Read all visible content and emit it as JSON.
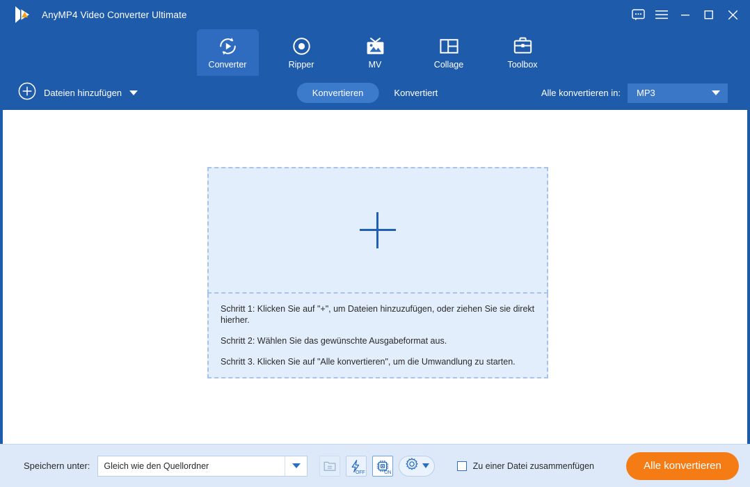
{
  "window": {
    "title": "AnyMP4 Video Converter Ultimate",
    "controls": [
      {
        "name": "feedback-icon",
        "label": "Feedback"
      },
      {
        "name": "menu-icon",
        "label": "Menu"
      },
      {
        "name": "minimize-icon",
        "label": "Minimieren"
      },
      {
        "name": "maximize-icon",
        "label": "Maximieren"
      },
      {
        "name": "close-icon",
        "label": "Schließen"
      }
    ]
  },
  "tabs": [
    {
      "label": "Converter",
      "icon": "convert-icon",
      "active": true
    },
    {
      "label": "Ripper",
      "icon": "disc-icon",
      "active": false
    },
    {
      "label": "MV",
      "icon": "mv-icon",
      "active": false
    },
    {
      "label": "Collage",
      "icon": "collage-icon",
      "active": false
    },
    {
      "label": "Toolbox",
      "icon": "toolbox-icon",
      "active": false
    }
  ],
  "toolbar": {
    "add_files_label": "Dateien hinzufügen",
    "add_files_icon": "plus-circle-icon",
    "segment_converting": "Konvertieren",
    "segment_converted": "Konvertiert",
    "convert_all_label": "Alle konvertieren in:",
    "format_value": "MP3"
  },
  "dropzone": {
    "plus_icon": "plus-icon",
    "steps": [
      "Schritt 1: Klicken Sie auf \"+\", um Dateien hinzuzufügen, oder ziehen Sie sie direkt hierher.",
      "Schritt 2: Wählen Sie das gewünschte Ausgabeformat aus.",
      "Schritt 3. Klicken Sie auf \"Alle konvertieren\", um die Umwandlung zu starten."
    ]
  },
  "bottom": {
    "save_to_label": "Speichern unter:",
    "save_to_value": "Gleich wie den Quellordner",
    "save_to_placeholder": "Gleich wie den Quellordner",
    "icons": [
      {
        "name": "open-folder-icon",
        "badge": ""
      },
      {
        "name": "fast-conversion-icon",
        "badge": "OFF"
      },
      {
        "name": "hardware-acceleration-icon",
        "badge": "ON"
      },
      {
        "name": "preferences-gear-icon",
        "badge": ""
      }
    ],
    "merge_label": "Zu einer Datei zusammenfügen",
    "merge_checked": false,
    "convert_all_button": "Alle konvertieren"
  },
  "colors": {
    "brand_blue": "#1f5bab",
    "tab_active": "#2f6cbf",
    "accent_orange": "#f57c15",
    "dropzone_fill": "#e3eefc",
    "bottom_bar": "#dde9f9"
  }
}
